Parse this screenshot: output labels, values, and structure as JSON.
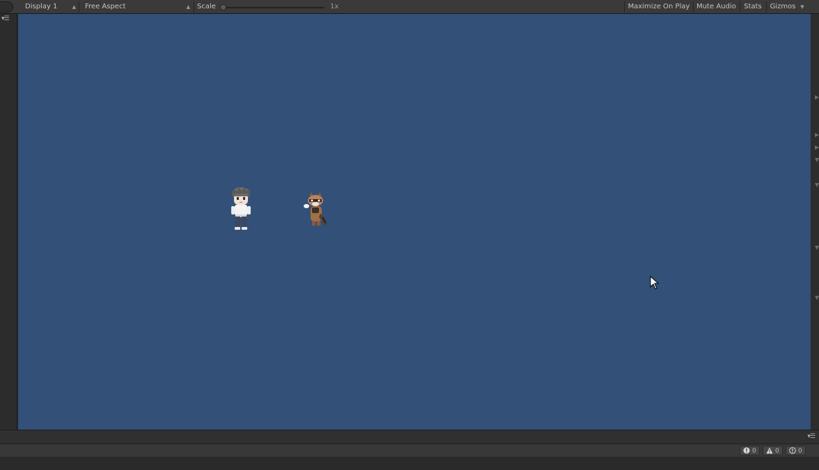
{
  "toolbar": {
    "display": "Display 1",
    "aspect": "Free Aspect",
    "scale_label": "Scale",
    "scale_value": "1x",
    "maximize_on_play": "Maximize On Play",
    "mute_audio": "Mute Audio",
    "stats": "Stats",
    "gizmos": "Gizmos"
  },
  "game_view": {
    "background_color": "#325078"
  },
  "console_counts": {
    "errors": "0",
    "warnings": "0",
    "messages": "0"
  },
  "icons": [
    "panel-menu-icon",
    "error-icon",
    "warning-icon",
    "info-icon",
    "mouse-cursor-icon",
    "dropdown-arrow-icon"
  ]
}
